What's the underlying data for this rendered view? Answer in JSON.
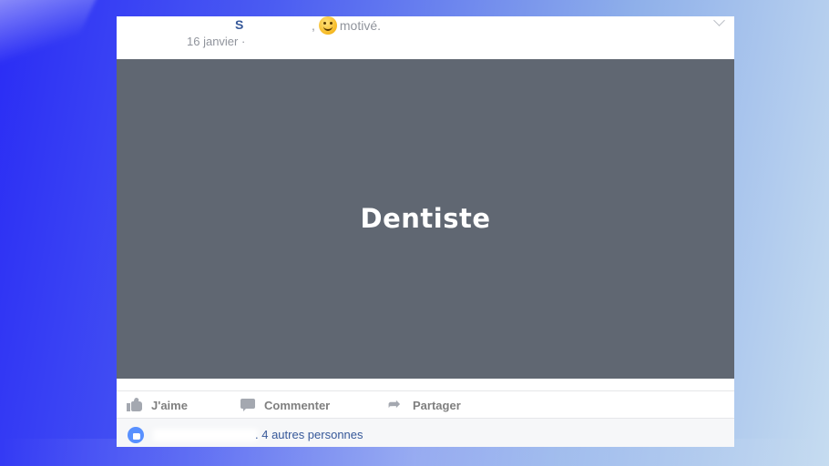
{
  "post": {
    "author_initial": "S",
    "feeling_prefix": ",",
    "feeling": "motivé.",
    "date": "16 janvier ·",
    "image_text": "Dentiste"
  },
  "actions": {
    "like_label": "J'aime",
    "comment_label": "Commenter",
    "share_label": "Partager"
  },
  "likes": {
    "text": ". 4 autres personnes"
  },
  "icons": {
    "feeling": "smiley-icon",
    "like": "like-icon",
    "comment": "comment-icon",
    "share": "share-icon",
    "menu": "chevron-down-icon",
    "like_badge": "like-badge-icon"
  },
  "colors": {
    "link": "#365899",
    "muted": "#90949c",
    "image_bg": "#606772",
    "like_badge": "#5890ff"
  }
}
